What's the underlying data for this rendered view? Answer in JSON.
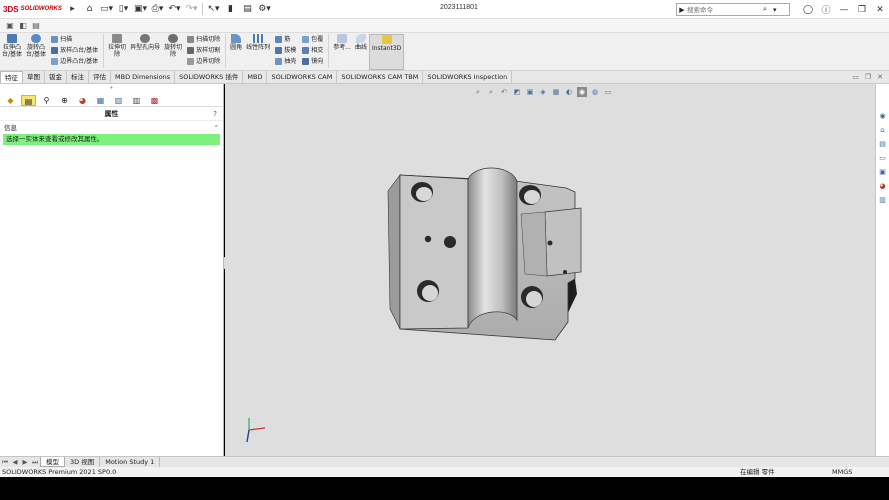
{
  "app": {
    "logo_mark": "3DS",
    "logo_text": "SOLIDWORKS"
  },
  "titlebar": {
    "doc_title": "2023111801",
    "search_placeholder": "搜索命令"
  },
  "ribbon": {
    "extrude_boss": "拉伸凸\n台/基体",
    "revolve_boss": "旋转凸\n台/基体",
    "sweep": "扫描",
    "loft_boss": "放样凸台/基体",
    "boundary_boss": "边界凸台/基体",
    "extrude_cut": "拉伸切\n除",
    "hole_wizard": "异型孔向导",
    "revolve_cut": "旋转切\n除",
    "swept_cut": "扫描切除",
    "lofted_cut": "放样切割",
    "boundary_cut": "边界切除",
    "fillet": "圆角",
    "linear_pattern": "线性阵列",
    "rib": "筋",
    "draft": "拔模",
    "shell": "抽壳",
    "wrap": "包覆",
    "intersect": "相交",
    "mirror": "镜向",
    "reference_geometry": "参考...",
    "curves": "曲线",
    "instant3d": "Instant3D"
  },
  "tabs": [
    "特征",
    "草图",
    "钣金",
    "标注",
    "评估",
    "MBD Dimensions",
    "SOLIDWORKS 插件",
    "MBD",
    "SOLIDWORKS CAM",
    "SOLIDWORKS CAM TBM",
    "SOLIDWORKS Inspection"
  ],
  "left_panel": {
    "title": "属性",
    "help": "?",
    "section": "信息",
    "message": "选择一实体来查看或修改其属性。"
  },
  "bottom_tabs": [
    "模型",
    "3D 视图",
    "Motion Study 1"
  ],
  "status": {
    "product": "SOLIDWORKS Premium 2021 SP0.0",
    "editing": "在编辑 零件",
    "units": "MMGS"
  },
  "colors": {
    "info_green": "#7cf27c",
    "viewport_bg": "#dedede",
    "part_body": "#b9b9b9",
    "part_dark": "#1e1e1e",
    "logo_red": "#d0021b"
  },
  "icons": [
    "home-icon",
    "new-icon",
    "open-icon",
    "save-icon",
    "print-icon",
    "undo-icon",
    "redo-icon",
    "select-icon",
    "rebuild-icon",
    "options-icon",
    "search-icon",
    "help-icon",
    "minimize-icon",
    "restore-icon",
    "close-icon"
  ]
}
